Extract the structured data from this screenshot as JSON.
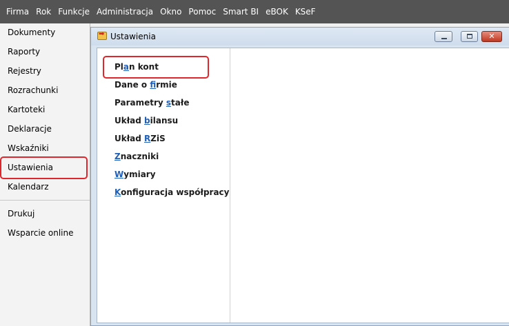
{
  "menubar": {
    "items": [
      {
        "label": "Firma"
      },
      {
        "label": "Rok"
      },
      {
        "label": "Funkcje"
      },
      {
        "label": "Administracja"
      },
      {
        "label": "Okno"
      },
      {
        "label": "Pomoc"
      },
      {
        "label": "Smart BI"
      },
      {
        "label": "eBOK"
      },
      {
        "label": "KSeF"
      }
    ]
  },
  "sidebar": {
    "items": [
      {
        "label": "Dokumenty"
      },
      {
        "label": "Raporty"
      },
      {
        "label": "Rejestry"
      },
      {
        "label": "Rozrachunki"
      },
      {
        "label": "Kartoteki"
      },
      {
        "label": "Deklaracje"
      },
      {
        "label": "Wskaźniki"
      },
      {
        "label": "Ustawienia",
        "selected": true
      },
      {
        "label": "Kalendarz"
      },
      {
        "label": "Drukuj"
      },
      {
        "label": "Wsparcie online"
      }
    ]
  },
  "window": {
    "title": "Ustawienia",
    "title_icon": "settings-arrow-icon",
    "buttons": {
      "minimize": "minimize-icon",
      "maximize": "maximize-icon",
      "close": "close-icon"
    },
    "close_glyph": "✕"
  },
  "settings": {
    "links": [
      {
        "pre": "Pl",
        "u": "a",
        "post": "n kont",
        "highlighted": true
      },
      {
        "pre": "Dane o ",
        "u": "f",
        "post": "irmie"
      },
      {
        "pre": "Parametry ",
        "u": "s",
        "post": "tałe"
      },
      {
        "pre": "Układ ",
        "u": "b",
        "post": "ilansu"
      },
      {
        "pre": "Układ ",
        "u": "R",
        "post": "ZiS"
      },
      {
        "pre": "",
        "u": "Z",
        "post": "naczniki"
      },
      {
        "pre": "",
        "u": "W",
        "post": "ymiary"
      },
      {
        "pre": "",
        "u": "K",
        "post": "onfiguracja współpracy"
      }
    ]
  },
  "colors": {
    "menubar_bg": "#545454",
    "highlight_border": "#e0262d",
    "window_frame": "#d9e4f1",
    "accent_link": "#1f5fb8"
  }
}
